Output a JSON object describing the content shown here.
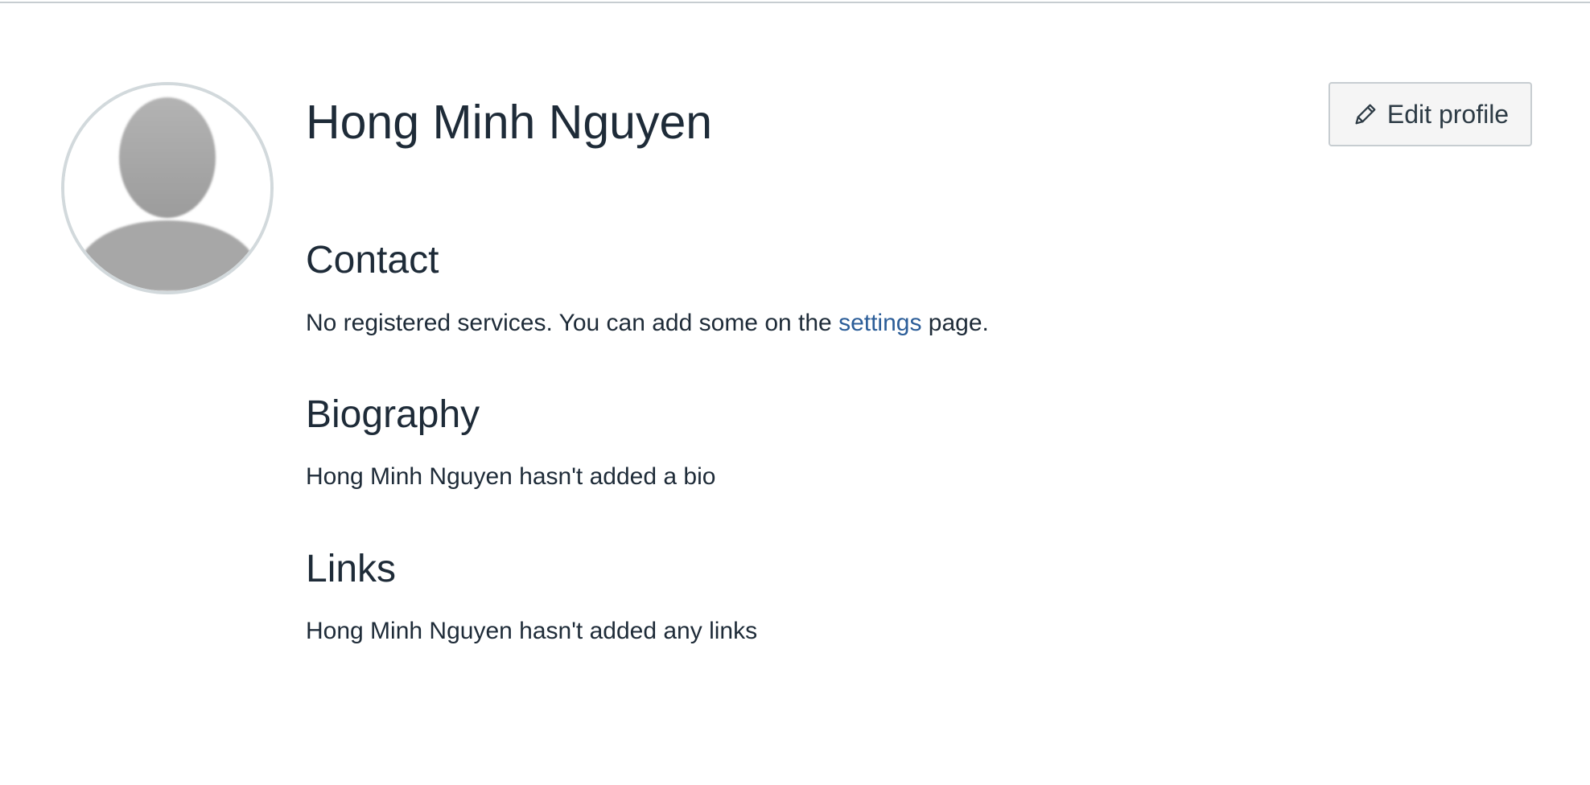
{
  "profile": {
    "name": "Hong Minh Nguyen",
    "edit_button_label": "Edit profile",
    "avatar_icon": "default-avatar-silhouette"
  },
  "contact": {
    "heading": "Contact",
    "text_before_link": "No registered services. You can add some on the ",
    "link_text": "settings",
    "text_after_link": " page."
  },
  "biography": {
    "heading": "Biography",
    "text": "Hong Minh Nguyen hasn't added a bio"
  },
  "links": {
    "heading": "Links",
    "text": "Hong Minh Nguyen hasn't added any links"
  },
  "colors": {
    "link": "#2b5d98",
    "text": "#1e2b38",
    "button_bg": "#f5f5f5",
    "button_border": "#c7cdd1",
    "avatar_border": "#d2d9dc"
  },
  "icons": {
    "edit": "pencil-icon"
  }
}
